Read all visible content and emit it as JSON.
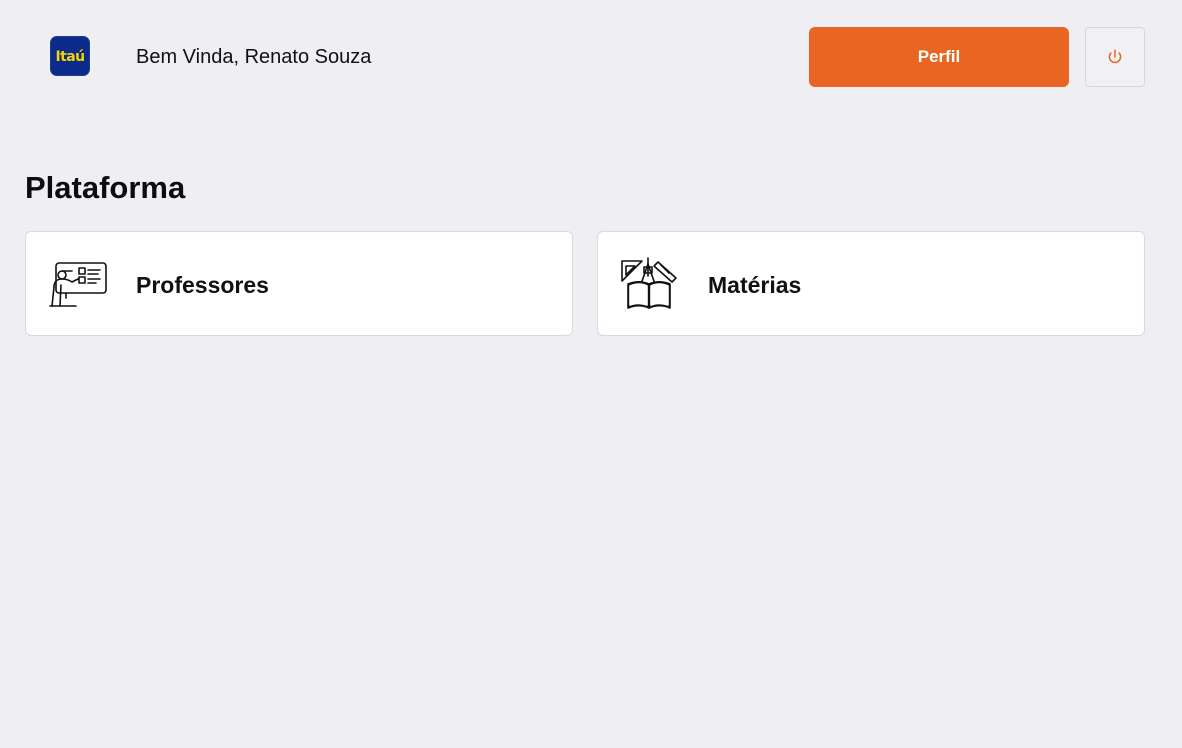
{
  "header": {
    "logo_text": "Itaú",
    "welcome_text": "Bem Vinda, Renato Souza",
    "profile_button_label": "Perfil",
    "logout_icon": "power-icon"
  },
  "main": {
    "section_title": "Plataforma",
    "cards": [
      {
        "label": "Professores",
        "icon": "teacher-board-icon"
      },
      {
        "label": "Matérias",
        "icon": "book-ruler-icon"
      }
    ]
  },
  "colors": {
    "page_background": "#efeef3",
    "accent": "#e86621",
    "logo_background": "#0b2a8a",
    "logo_text": "#f5d400",
    "card_background": "#ffffff",
    "card_border": "#d9d8de",
    "text_primary": "#111111"
  }
}
